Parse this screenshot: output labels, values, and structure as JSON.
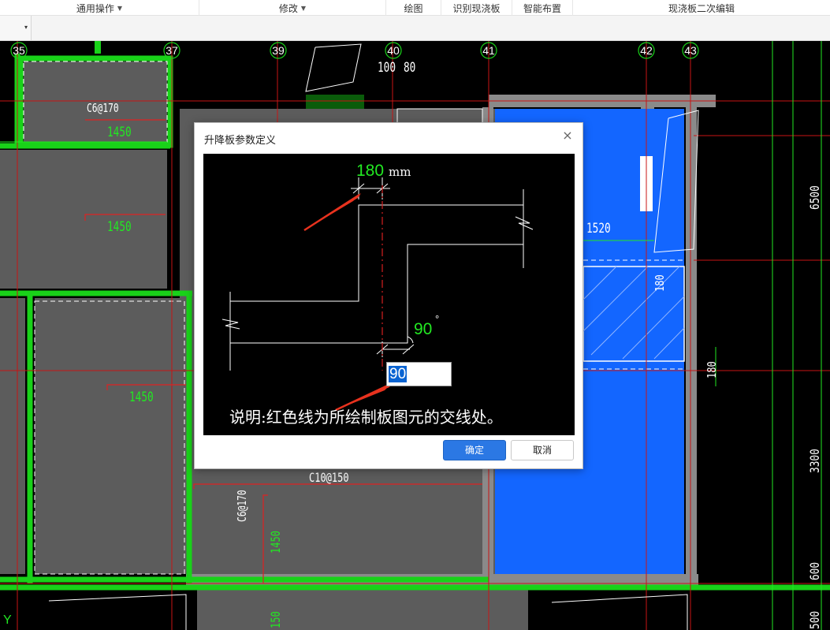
{
  "ribbon": {
    "groups": [
      {
        "label": "通用操作",
        "caret": "▼"
      },
      {
        "label": "修改",
        "caret": "▼"
      },
      {
        "label": "绘图"
      },
      {
        "label": "识别现浇板"
      },
      {
        "label": "智能布置"
      },
      {
        "label": "现浇板二次编辑"
      }
    ]
  },
  "toolbar": {
    "dropdown_caret": "▾"
  },
  "canvas": {
    "axes": [
      "35",
      "37",
      "39",
      "40",
      "41",
      "42",
      "43"
    ],
    "labels": {
      "rebar_c6_170": "C6@170",
      "rebar_c6_170_b": "C6@170",
      "rebar_c10_150": "C10@150",
      "len_1450_a": "1450",
      "len_1450_b": "1450",
      "len_1450_c": "1450",
      "len_1450_d": "1450",
      "len_150": "150",
      "dim_100": "100",
      "dim_80": "80",
      "dim_1520": "1520",
      "dim_180_a": "180",
      "dim_180_b": "180",
      "dim_6500": "6500",
      "dim_3300": "3300",
      "dim_600": "600",
      "dim_500": "500",
      "y_axis": "Y"
    }
  },
  "dialog": {
    "title": "升降板参数定义",
    "close": "×",
    "preview": {
      "offset_value": "180",
      "offset_unit": "mm",
      "angle_value": "90",
      "angle_unit": "°",
      "note": "说明:红色线为所绘制板图元的交线处。"
    },
    "angle_input": {
      "value": "90"
    },
    "ok_label": "确定",
    "cancel_label": "取消"
  },
  "colors": {
    "wall_green": "#19d219",
    "slab_gray": "#5c5c5c",
    "slab_blue": "#1366ff",
    "axis_red": "#c81414",
    "dim_green": "#22e822",
    "arrow_red": "#e8321e"
  }
}
